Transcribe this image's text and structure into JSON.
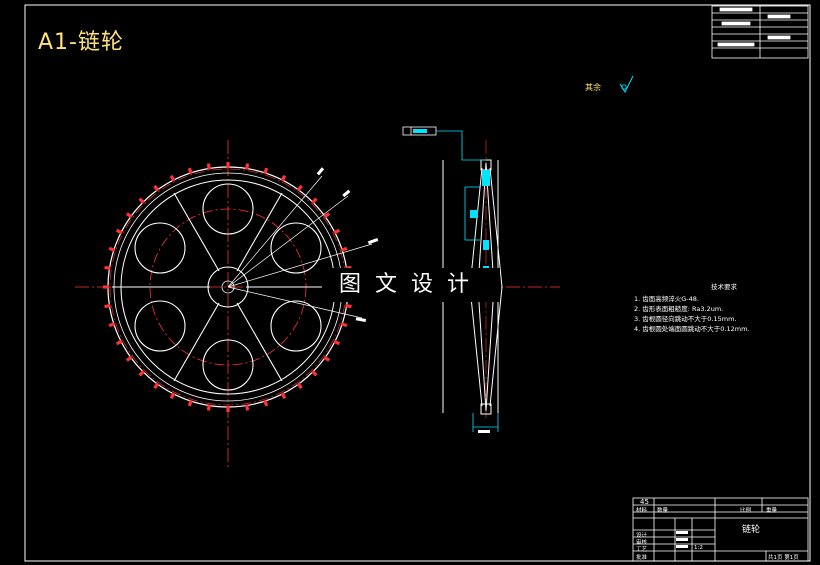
{
  "drawing": {
    "title": "A1-链轮",
    "surface_note": "其余",
    "watermark": "图文设计",
    "tech_requirements": {
      "heading": "技术要求",
      "items": [
        "1. 齿面高频淬火G-48.",
        "2. 齿形表面粗糙度: Ra3.2um.",
        "3. 齿根圆径向跳动不大于0.15mm.",
        "4. 齿根圆处端面圆跳动不大于0.12mm."
      ]
    },
    "title_block": {
      "part_name": "链轮",
      "scale": "1:2",
      "sheet": "共1页 第1页",
      "code": "45",
      "row_labels": [
        "设计",
        "审核",
        "工艺",
        "批准"
      ],
      "small_labels": [
        "材料",
        "数量",
        "比例",
        "重量"
      ]
    }
  },
  "colors": {
    "background": "#000000",
    "outline": "#ffffff",
    "centerline": "#ff3333",
    "dimension": "#00e5ff",
    "title": "#ffe37a"
  }
}
